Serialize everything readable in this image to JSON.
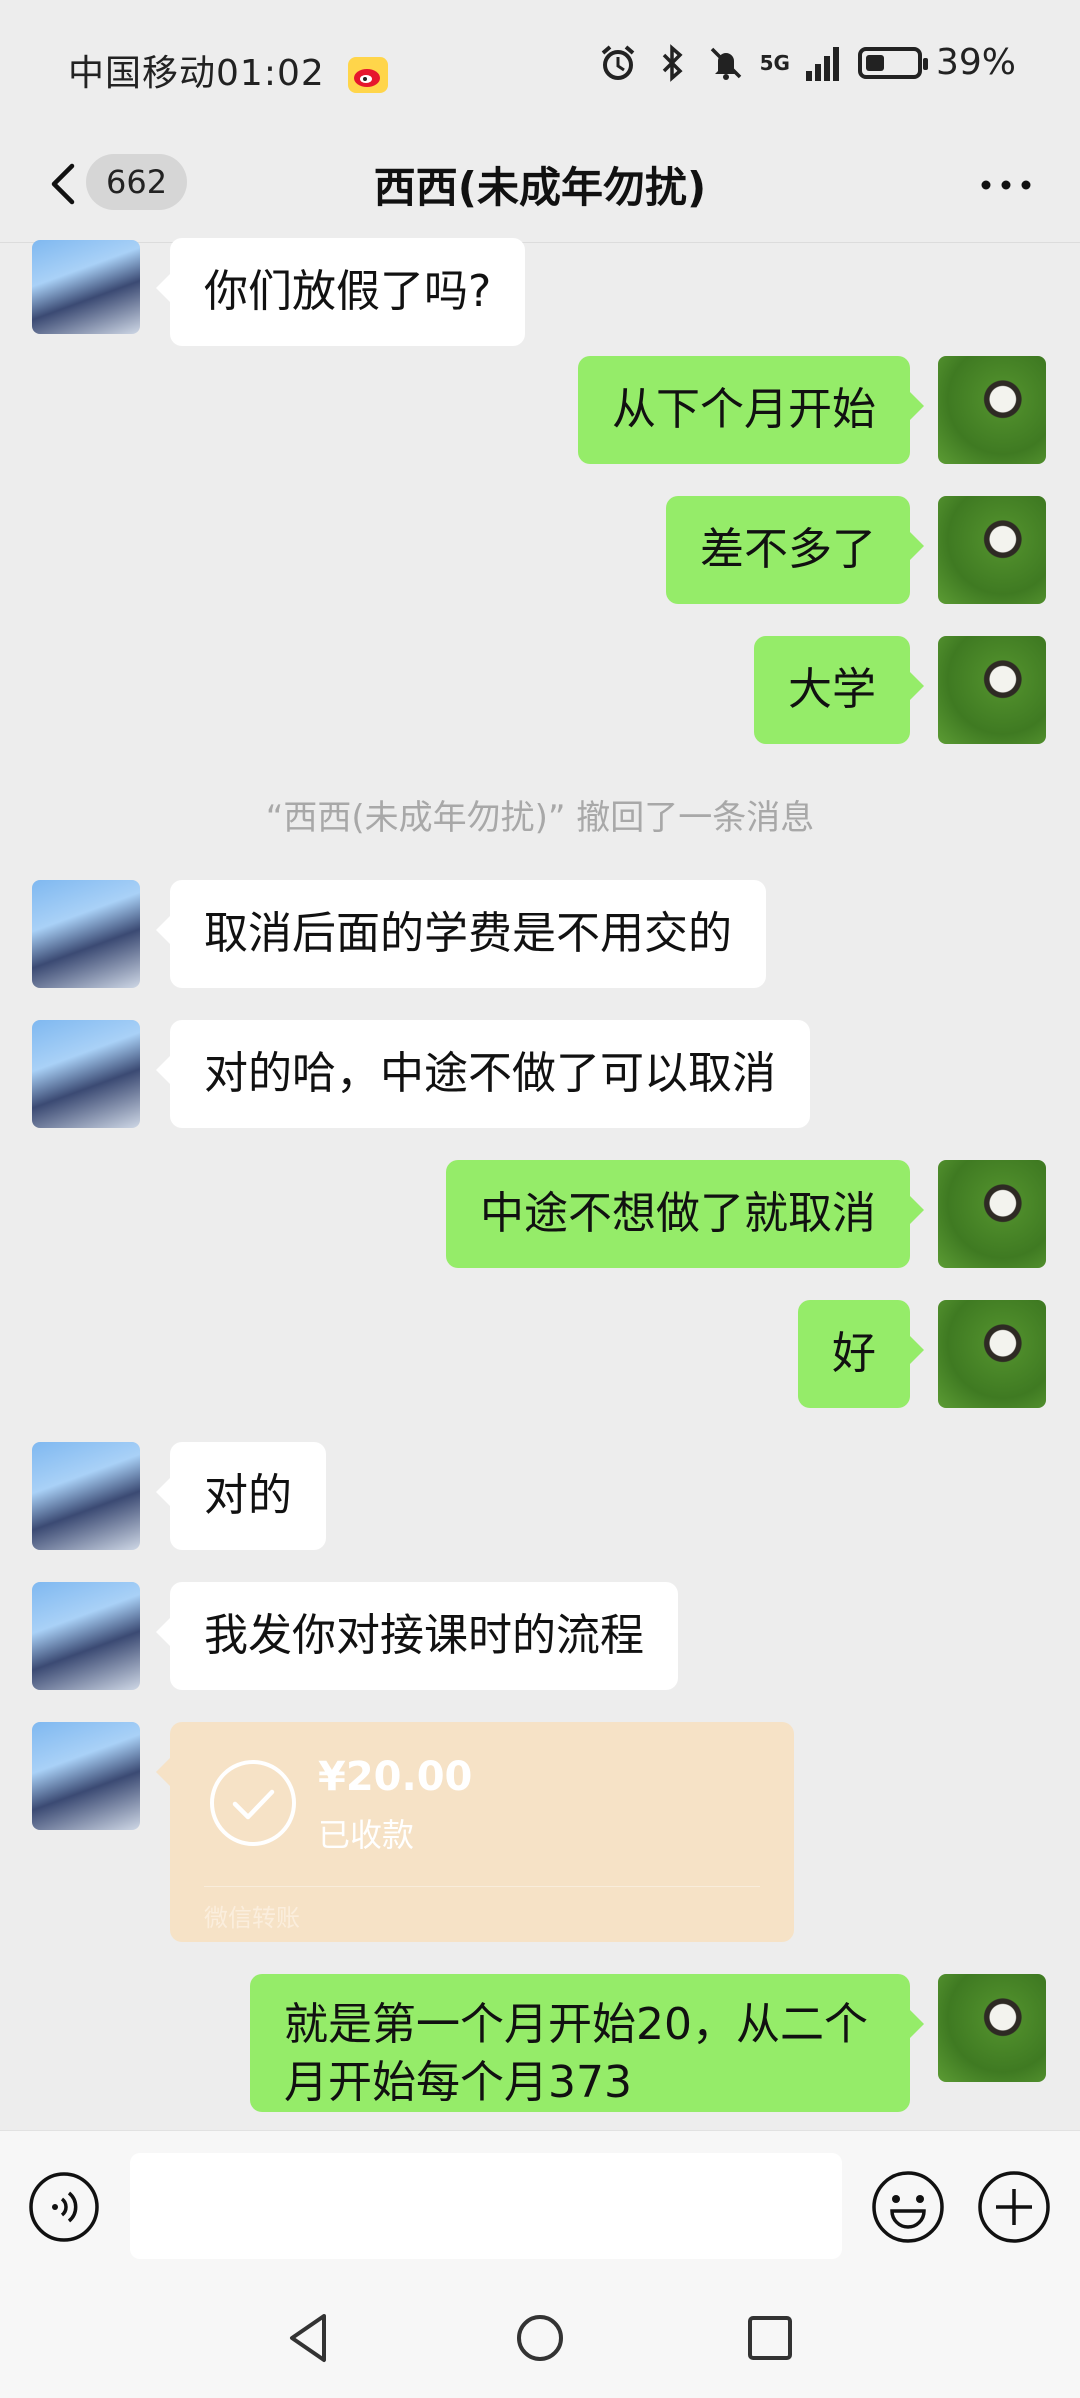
{
  "status_bar": {
    "carrier": "中国移动",
    "time": "01:02",
    "network": "5G",
    "battery": "39%",
    "battery_level_percent": 39
  },
  "nav": {
    "unread_count": "662",
    "title": "西西(未成年勿扰)"
  },
  "messages": [
    {
      "side": "left",
      "text": "你们放假了吗?"
    },
    {
      "side": "right",
      "text": "从下个月开始"
    },
    {
      "side": "right",
      "text": "差不多了"
    },
    {
      "side": "right",
      "text": "大学"
    },
    {
      "system": "“西西(未成年勿扰)” 撤回了一条消息"
    },
    {
      "side": "left",
      "text": "取消后面的学费是不用交的"
    },
    {
      "side": "left",
      "text": "对的哈，中途不做了可以取消"
    },
    {
      "side": "right",
      "text": "中途不想做了就取消"
    },
    {
      "side": "right",
      "text": "好"
    },
    {
      "side": "left",
      "text": "对的"
    },
    {
      "side": "left",
      "text": "我发你对接课时的流程"
    },
    {
      "side": "left",
      "transfer": {
        "amount": "¥20.00",
        "status": "已收款",
        "source": "微信转账"
      }
    },
    {
      "side": "right",
      "text": "就是第一个月开始20，从二个月开始每个月373"
    }
  ],
  "input": {
    "placeholder": ""
  },
  "icons": {
    "voice": "voice-icon",
    "emoji": "emoji-icon",
    "plus": "plus-icon",
    "back": "back-icon",
    "more": "more-icon"
  },
  "colors": {
    "background": "#ededed",
    "my_bubble": "#95ec69",
    "their_bubble": "#ffffff",
    "transfer_card": "#f6e2c6"
  }
}
